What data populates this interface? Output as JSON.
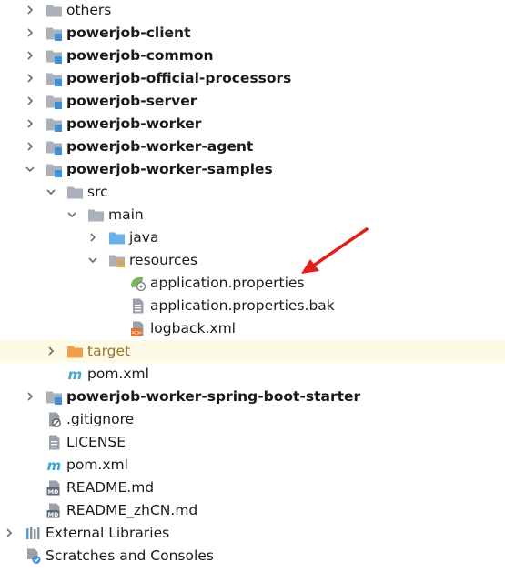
{
  "items": [
    {
      "label": "others",
      "bold": false,
      "chevron": "right",
      "icon": "folder-icon"
    },
    {
      "label": "powerjob-client",
      "bold": true,
      "chevron": "right",
      "icon": "module-folder-icon"
    },
    {
      "label": "powerjob-common",
      "bold": true,
      "chevron": "right",
      "icon": "module-folder-icon"
    },
    {
      "label": "powerjob-official-processors",
      "bold": true,
      "chevron": "right",
      "icon": "module-folder-icon"
    },
    {
      "label": "powerjob-server",
      "bold": true,
      "chevron": "right",
      "icon": "module-folder-icon"
    },
    {
      "label": "powerjob-worker",
      "bold": true,
      "chevron": "right",
      "icon": "module-folder-icon"
    },
    {
      "label": "powerjob-worker-agent",
      "bold": true,
      "chevron": "right",
      "icon": "module-folder-icon"
    },
    {
      "label": "powerjob-worker-samples",
      "bold": true,
      "chevron": "down",
      "icon": "module-folder-icon"
    },
    {
      "label": "src",
      "bold": false,
      "chevron": "down",
      "icon": "folder-icon"
    },
    {
      "label": "main",
      "bold": false,
      "chevron": "down",
      "icon": "folder-icon"
    },
    {
      "label": "java",
      "bold": false,
      "chevron": "right",
      "icon": "source-folder-icon"
    },
    {
      "label": "resources",
      "bold": false,
      "chevron": "down",
      "icon": "resources-folder-icon"
    },
    {
      "label": "application.properties",
      "bold": false,
      "chevron": "none",
      "icon": "spring-properties-icon"
    },
    {
      "label": "application.properties.bak",
      "bold": false,
      "chevron": "none",
      "icon": "text-file-icon"
    },
    {
      "label": "logback.xml",
      "bold": false,
      "chevron": "none",
      "icon": "xml-file-icon"
    },
    {
      "label": "target",
      "bold": false,
      "chevron": "right",
      "icon": "excluded-folder-icon",
      "muted": true,
      "highlight": true
    },
    {
      "label": "pom.xml",
      "bold": false,
      "chevron": "none",
      "icon": "maven-icon"
    },
    {
      "label": "powerjob-worker-spring-boot-starter",
      "bold": true,
      "chevron": "right",
      "icon": "module-folder-icon"
    },
    {
      "label": ".gitignore",
      "bold": false,
      "chevron": "none",
      "icon": "ignore-file-icon"
    },
    {
      "label": "LICENSE",
      "bold": false,
      "chevron": "none",
      "icon": "text-file-icon"
    },
    {
      "label": "pom.xml",
      "bold": false,
      "chevron": "none",
      "icon": "maven-icon"
    },
    {
      "label": "README.md",
      "bold": false,
      "chevron": "none",
      "icon": "markdown-icon"
    },
    {
      "label": "README_zhCN.md",
      "bold": false,
      "chevron": "none",
      "icon": "markdown-icon"
    },
    {
      "label": "External Libraries",
      "bold": false,
      "chevron": "right",
      "icon": "libraries-icon"
    },
    {
      "label": "Scratches and Consoles",
      "bold": false,
      "chevron": "none",
      "icon": "scratches-icon"
    }
  ],
  "annotation": {
    "icon": "red-arrow-icon",
    "color": "#e0201b"
  },
  "colors": {
    "folder": "#aab1bb",
    "module_mark": "#3d8fd8",
    "source_folder": "#6cb0e8",
    "excluded_folder": "#f0a04b",
    "selection_bg": "#fdfbe6"
  }
}
